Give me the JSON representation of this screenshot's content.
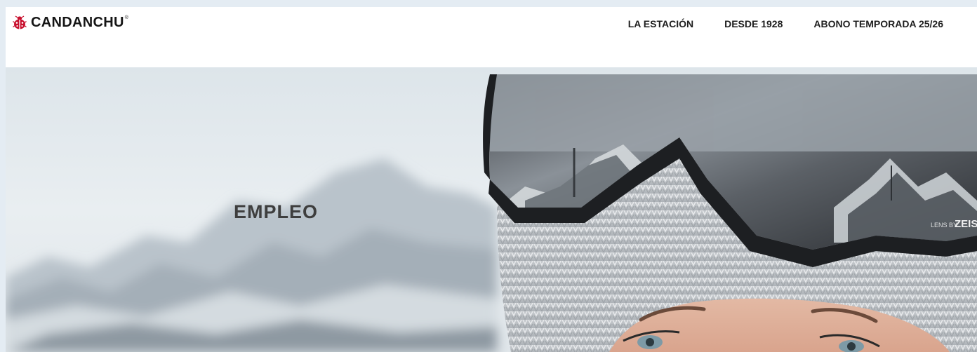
{
  "brand": {
    "name": "CANDANCHU",
    "trademark": "®",
    "logo_color": "#c8102e"
  },
  "nav": {
    "items": [
      {
        "label": "LA ESTACIÓN"
      },
      {
        "label": "DESDE 1928"
      },
      {
        "label": "ABONO TEMPORADA 25/26"
      }
    ]
  },
  "hero": {
    "title": "EMPLEO",
    "goggle_lens_text": "LENS BY ZEISS"
  }
}
